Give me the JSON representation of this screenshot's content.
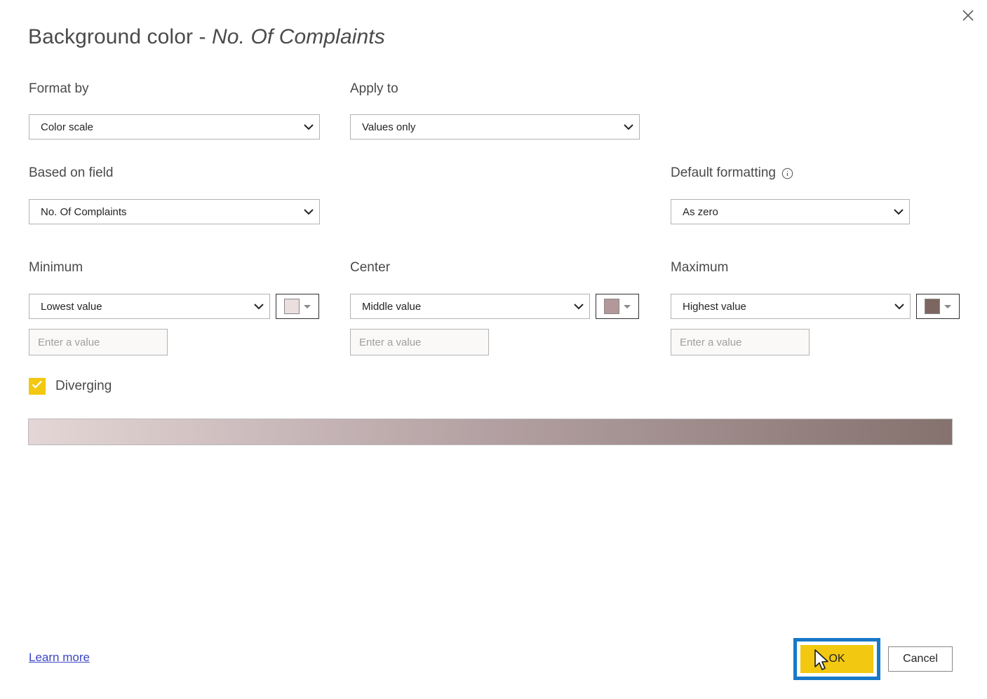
{
  "dialog": {
    "title_prefix": "Background color - ",
    "title_field": "No. Of Complaints",
    "close_label": "Close"
  },
  "format_by": {
    "label": "Format by",
    "value": "Color scale"
  },
  "apply_to": {
    "label": "Apply to",
    "value": "Values only"
  },
  "based_on_field": {
    "label": "Based on field",
    "value": "No. Of Complaints"
  },
  "default_formatting": {
    "label": "Default formatting",
    "info_icon": "info-icon",
    "value": "As zero"
  },
  "minimum": {
    "label": "Minimum",
    "value": "Lowest value",
    "color": "#EADEDE",
    "input_placeholder": "Enter a value",
    "input_value": ""
  },
  "center": {
    "label": "Center",
    "value": "Middle value",
    "color": "#B2989A",
    "input_placeholder": "Enter a value",
    "input_value": ""
  },
  "maximum": {
    "label": "Maximum",
    "value": "Highest value",
    "color": "#7D6660",
    "input_placeholder": "Enter a value",
    "input_value": ""
  },
  "diverging": {
    "label": "Diverging",
    "checked": true,
    "check_color": "#F2C811"
  },
  "gradient": {
    "start_color": "#E4D6D6",
    "mid_color": "#B3A0A2",
    "end_color": "#85726E"
  },
  "footer": {
    "learn_more": "Learn more",
    "ok_label": "OK",
    "cancel_label": "Cancel",
    "ok_button_color": "#F2C811",
    "highlight_color": "#1878C8"
  }
}
